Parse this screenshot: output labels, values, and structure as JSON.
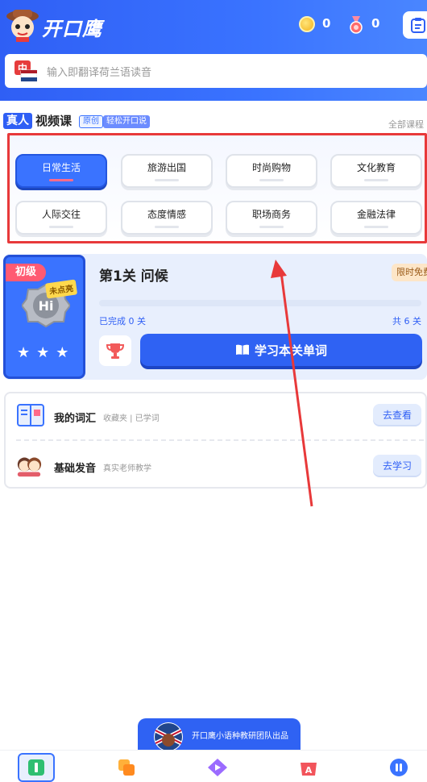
{
  "header": {
    "app_title": "开口鹰",
    "coins": "0",
    "medals": "0"
  },
  "search": {
    "flag_text": "中",
    "placeholder": "输入即翻译荷兰语读音"
  },
  "video_section": {
    "badge": "真人",
    "title": "视频课",
    "tag_original": "原创",
    "tag_easy": "轻松开口说",
    "all_link": "全部课程"
  },
  "categories": [
    {
      "label": "日常生活",
      "active": true
    },
    {
      "label": "旅游出国",
      "active": false
    },
    {
      "label": "时尚购物",
      "active": false
    },
    {
      "label": "文化教育",
      "active": false
    },
    {
      "label": "人际交往",
      "active": false
    },
    {
      "label": "态度情感",
      "active": false
    },
    {
      "label": "职场商务",
      "active": false
    },
    {
      "label": "金融法律",
      "active": false
    }
  ],
  "lesson": {
    "level": "初级",
    "not_scored": "未点亮",
    "hi_text": "Hi",
    "title": "第1关 问候",
    "free_tag": "限时免费",
    "done": "已完成 0 关",
    "total": "共 6 关",
    "progress": 0,
    "study_button": "学习本关单词"
  },
  "vocab_rows": [
    {
      "title": "我的词汇",
      "subtitle": "收藏夹 | 已学词",
      "button": "去查看"
    },
    {
      "title": "基础发音",
      "subtitle": "真实老师教学",
      "button": "去学习"
    }
  ],
  "team_banner": {
    "text": "开口鹰小语种教研团队出品"
  },
  "colors": {
    "primary": "#3a73ff",
    "highlight": "#e8393a"
  },
  "bottom_nav": [
    {
      "icon": "home-icon",
      "active": true
    },
    {
      "icon": "cards-icon",
      "active": false
    },
    {
      "icon": "video-play-icon",
      "active": false
    },
    {
      "icon": "dictionary-icon",
      "active": false
    },
    {
      "icon": "chat-icon",
      "active": false
    }
  ]
}
